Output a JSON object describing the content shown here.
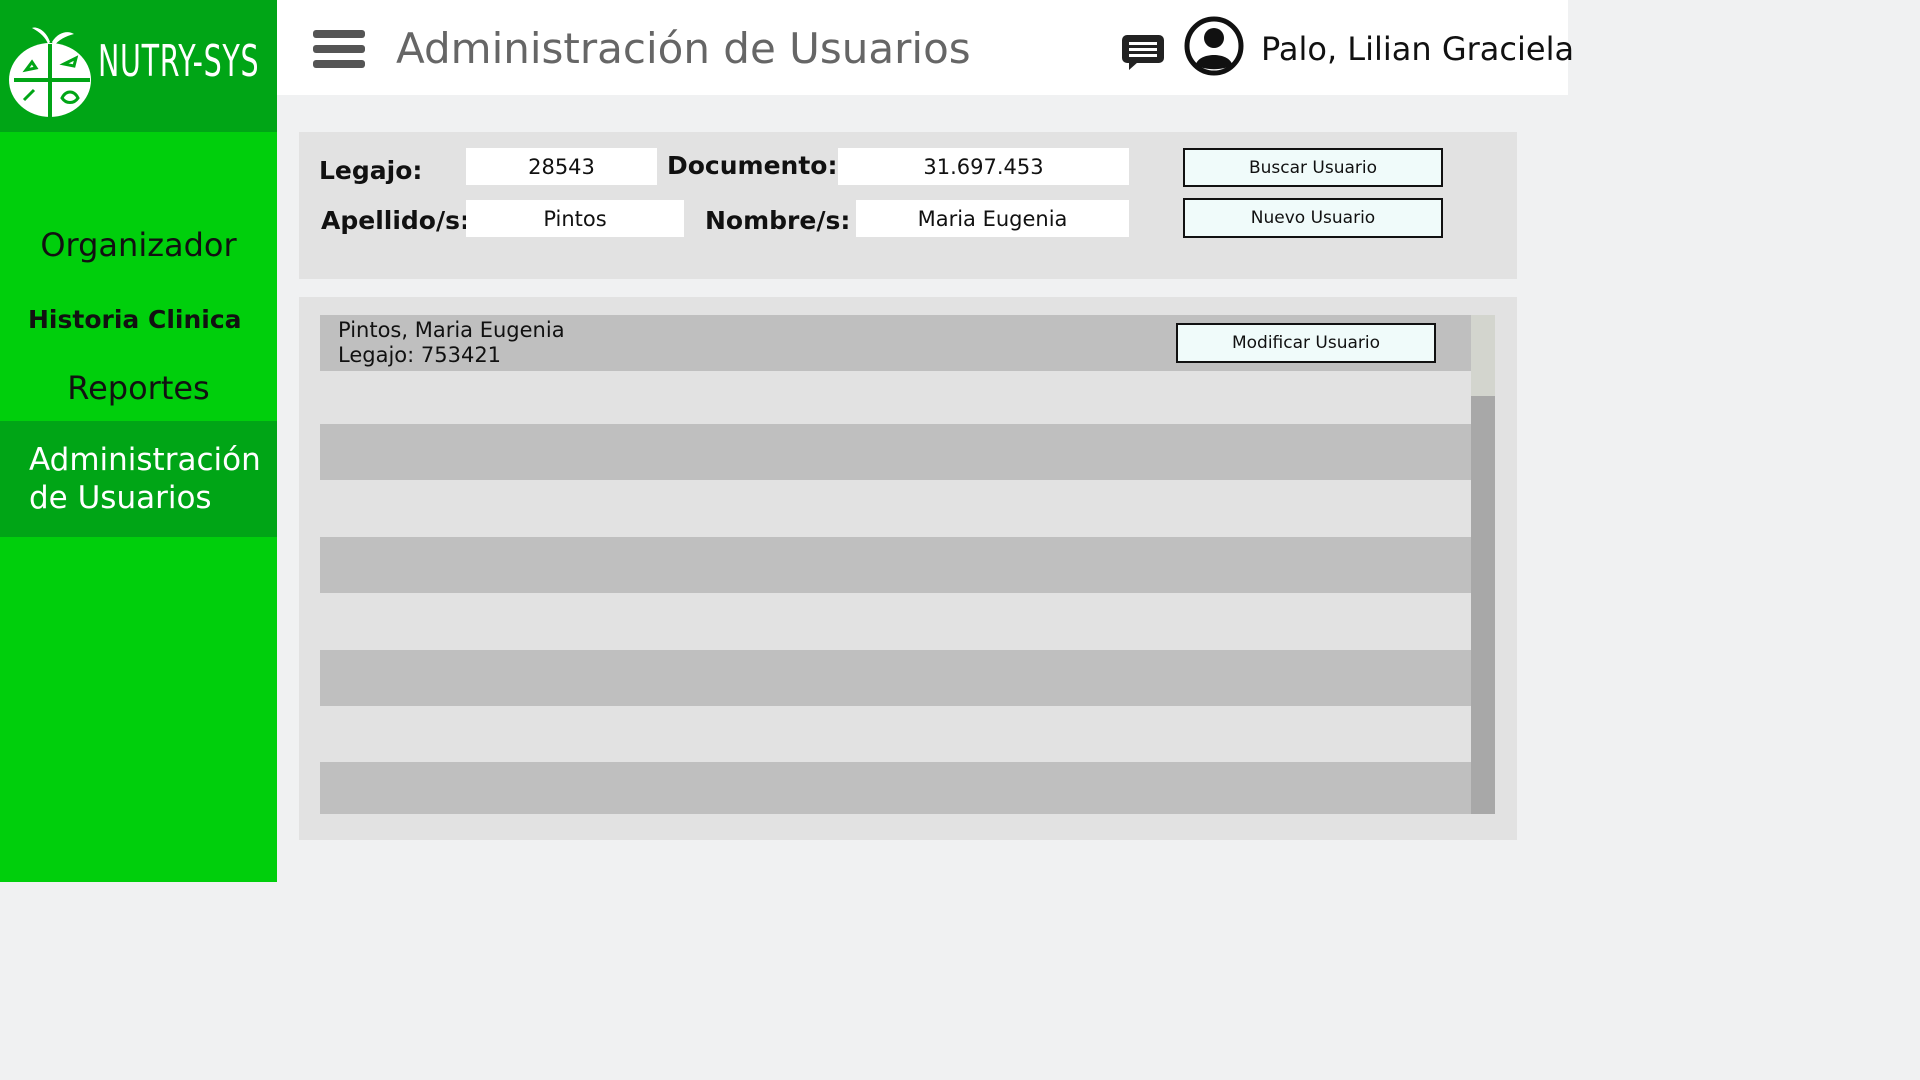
{
  "app": {
    "logo_text": "NUTRY-SYS"
  },
  "sidebar": {
    "items": [
      {
        "label": "Organizador"
      },
      {
        "label": "Historia Clinica"
      },
      {
        "label": "Reportes"
      },
      {
        "label": "Administración de Usuarios",
        "active": true
      }
    ]
  },
  "header": {
    "title": "Administración de Usuarios",
    "menu_icon": "hamburger-menu-icon",
    "chat_icon": "chat-icon",
    "avatar_icon": "user-avatar-icon",
    "user_name": "Palo, Lilian Graciela"
  },
  "search": {
    "legajo_label": "Legajo:",
    "legajo_value": "28543",
    "documento_label": "Documento:",
    "documento_value": "31.697.453",
    "apellido_label": "Apellido/s:",
    "apellido_value": "Pintos",
    "nombre_label": "Nombre/s:",
    "nombre_value": "Maria Eugenia",
    "buscar_button": "Buscar Usuario",
    "nuevo_button": "Nuevo Usuario"
  },
  "results": {
    "rows": [
      {
        "name": "Pintos, Maria Eugenia",
        "legajo": "Legajo: 753421",
        "action": "Modificar Usuario"
      }
    ]
  },
  "colors": {
    "sidebar_green": "#00cf0c",
    "sidebar_dark_green": "#00a516",
    "panel_gray": "#e2e2e2",
    "row_gray": "#bfbfbf",
    "button_bg": "#f0fbfa"
  }
}
